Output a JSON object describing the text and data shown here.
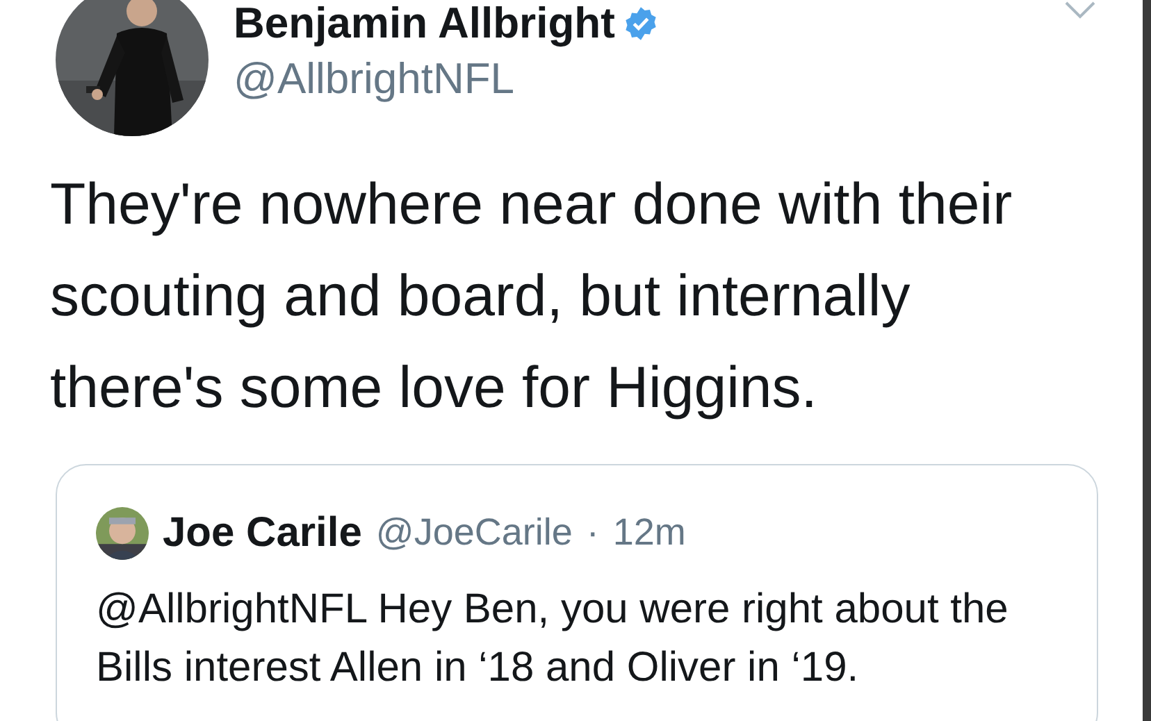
{
  "author": {
    "name": "Benjamin Allbright",
    "verified": true,
    "handle": "@AllbrightNFL"
  },
  "tweet": {
    "text": "They're nowhere near done with their scouting and board, but internally there's some love for Higgins."
  },
  "quoted_tweet": {
    "name": "Joe Carile",
    "handle": "@JoeCarile",
    "separator": "·",
    "time": "12m",
    "text": "@AllbrightNFL Hey Ben, you were right about the Bills interest Allen in ‘18 and Oliver in ‘19."
  }
}
